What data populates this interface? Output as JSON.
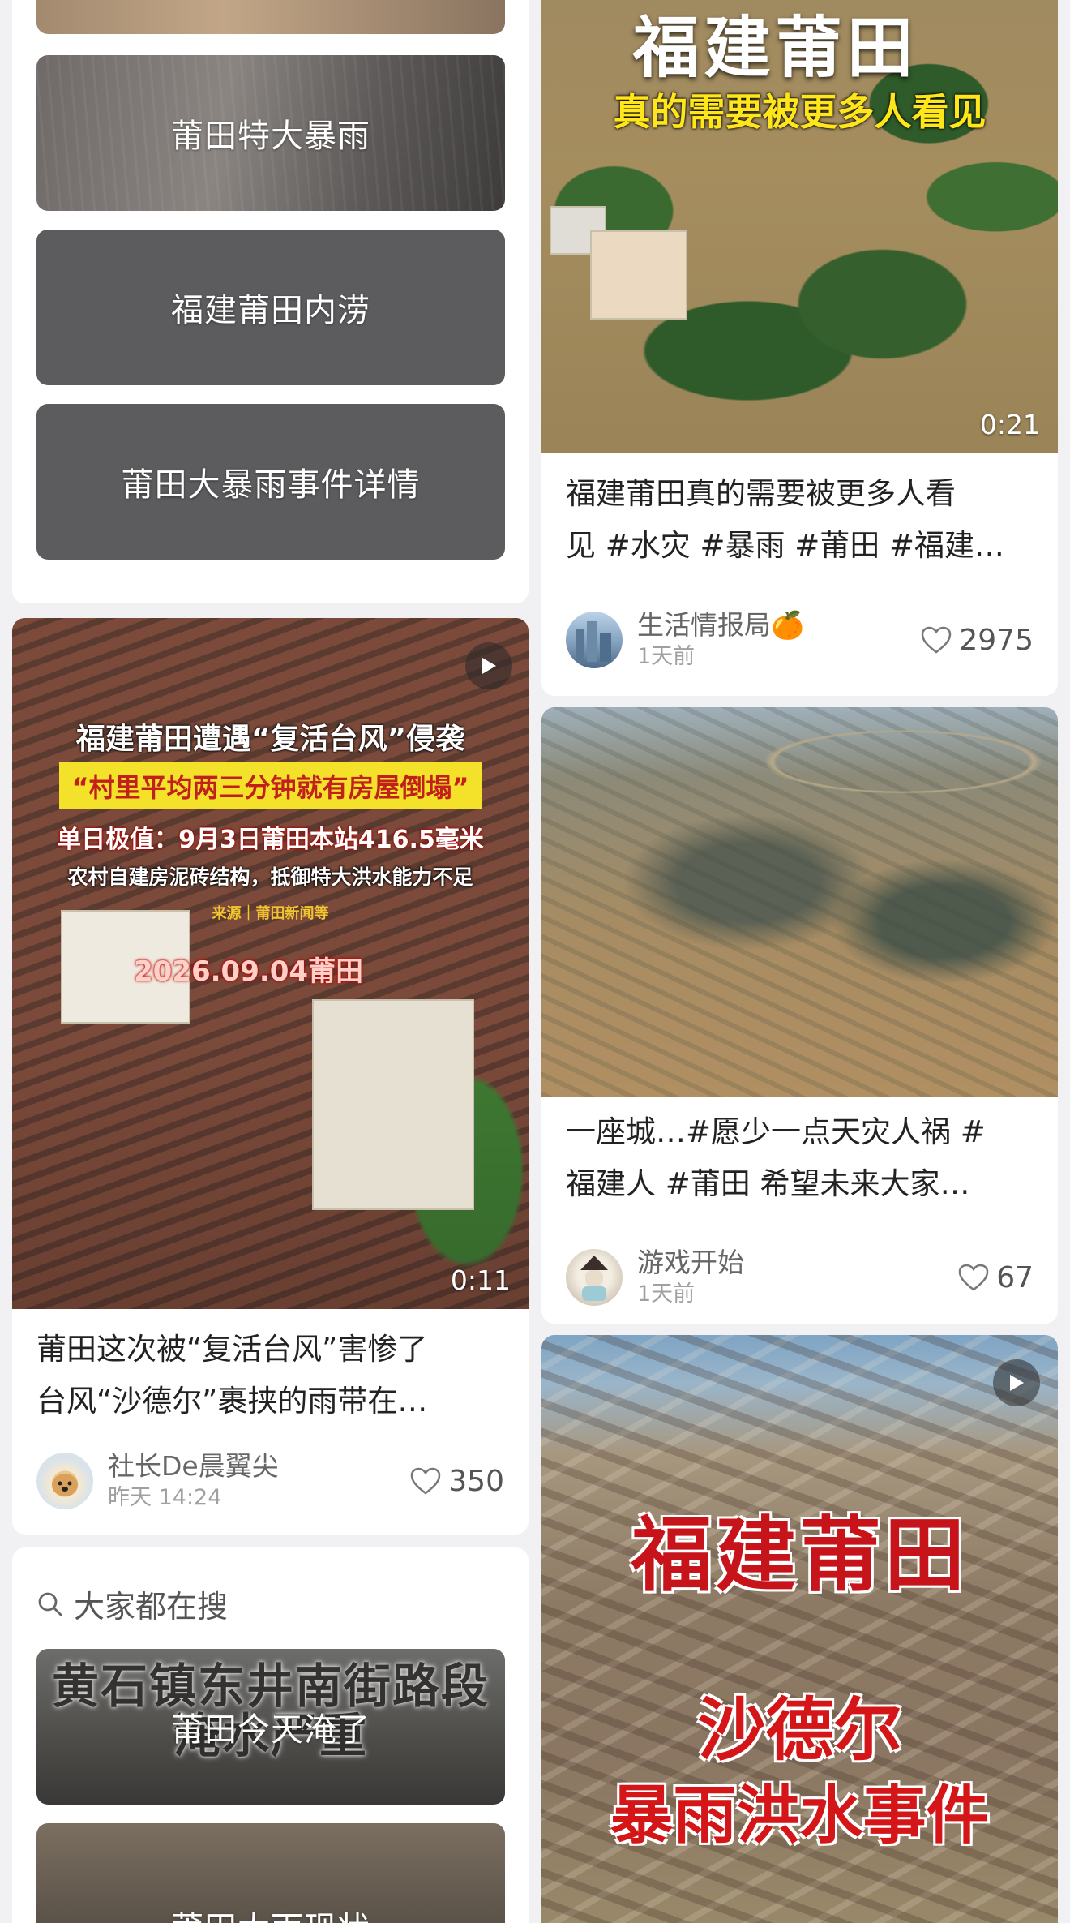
{
  "search_suggestions_top": {
    "items": [
      {
        "label": "莆田特大暴雨"
      },
      {
        "label": "福建莆田内涝"
      },
      {
        "label": "莆田大暴雨事件详情"
      }
    ]
  },
  "search_suggestions_bottom": {
    "header": "大家都在搜",
    "items": [
      {
        "label": "莆田今天淹了",
        "image_text": "黄石镇东井南街路段\n淹水严重"
      },
      {
        "label": "莆田大雨现状"
      }
    ]
  },
  "posts": [
    {
      "image_title": "福建莆田",
      "image_subtitle": "真的需要被更多人看见",
      "duration": "0:21",
      "title_lines": [
        "福建莆田真的需要被更多人看",
        "见 #水灾 #暴雨 #莆田 #福建…"
      ],
      "author": "生活情报局🍊",
      "time": "1天前",
      "likes": "2975"
    },
    {
      "title_lines": [
        "一座城…#愿少一点天灾人祸 #",
        "福建人 #莆田 希望未来大家…"
      ],
      "author": "游戏开始",
      "time": "1天前",
      "likes": "67"
    },
    {
      "image_lines": [
        "福建莆田遭遇“复活台风”侵袭",
        "“村里平均两三分钟就有房屋倒塌”",
        "单日极值：9月3日莆田本站416.5毫米",
        "农村自建房泥砖结构，抵御特大洪水能力不足",
        "来源｜莆田新闻等"
      ],
      "image_date": "2026.09.04莆田",
      "duration": "0:11",
      "title_lines": [
        "莆田这次被“复活台风”害惨了",
        "台风“沙德尔”裹挟的雨带在…"
      ],
      "author": "社长De晨翼尖",
      "time": "昨天 14:24",
      "likes": "350"
    },
    {
      "image_title": "福建莆田",
      "image_sub1": "沙德尔",
      "image_sub2": "暴雨洪水事件"
    }
  ],
  "colors": {
    "page_bg": "#f1f1f3",
    "card_bg": "#ffffff",
    "suggestion_bg": "#5c5c5e",
    "yellow_banner": "#ffe61a",
    "red_text": "#c7141a"
  }
}
